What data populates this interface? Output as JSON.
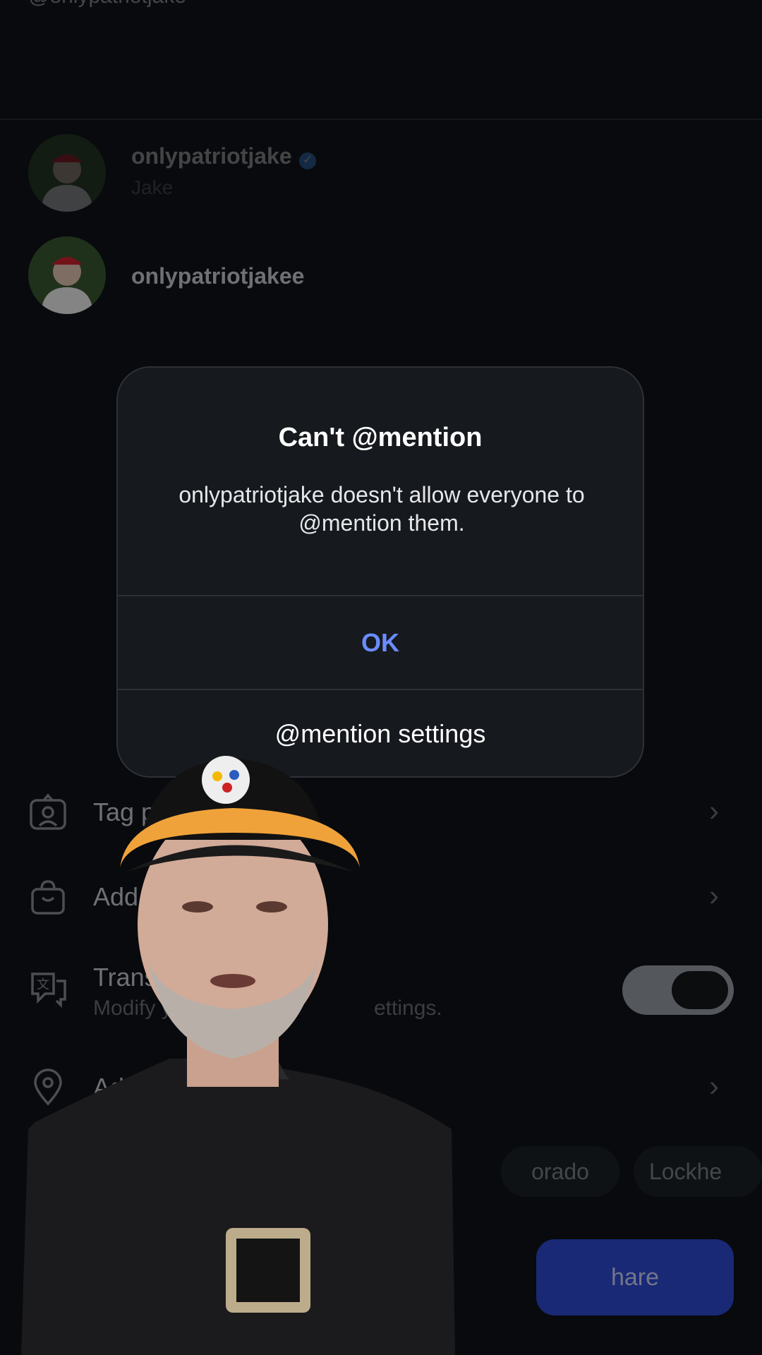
{
  "top_handle": "@onlypatriotjake",
  "users": [
    {
      "username": "onlypatriotjake",
      "name": "Jake",
      "verified": true
    },
    {
      "username": "onlypatriotjakee",
      "name": "",
      "verified": false
    }
  ],
  "rows": {
    "tag_people": "Tag peo",
    "add_product": "Add pr",
    "translate_label": "Transla",
    "translate_sub_left": "Modify y",
    "translate_sub_right": "ettings.",
    "add_location": "Add "
  },
  "chips": [
    "orado",
    "Lockhe"
  ],
  "share_label": "hare",
  "dialog": {
    "title": "Can't @mention",
    "message": "onlypatriotjake doesn't allow everyone to @mention them.",
    "ok": "OK",
    "settings": "@mention settings"
  },
  "icons": [
    "tag-person-icon",
    "shopping-bag-icon",
    "translate-icon",
    "location-pin-icon",
    "chevron-right-icon",
    "verified-icon"
  ],
  "colors": {
    "accent": "#6a8cff",
    "verified": "#3f8ff6",
    "share": "#2f4bd6"
  }
}
